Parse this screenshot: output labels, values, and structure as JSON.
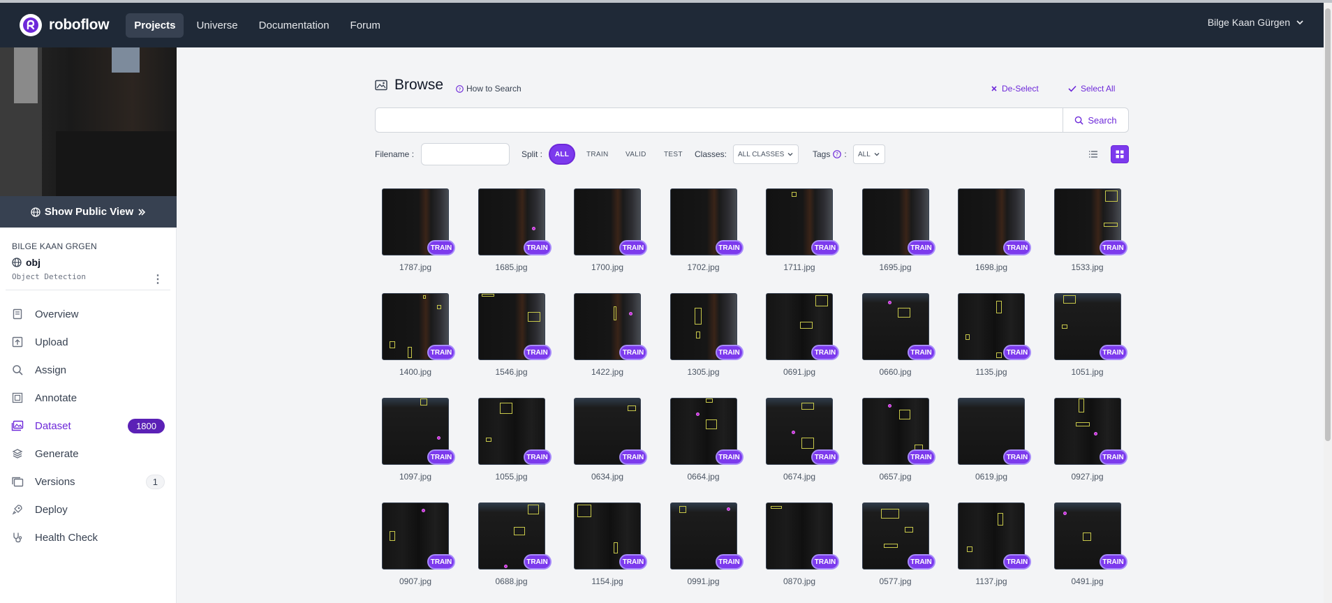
{
  "nav": {
    "brand": "roboflow",
    "links": [
      "Projects",
      "Universe",
      "Documentation",
      "Forum"
    ],
    "user": "Bilge Kaan Gürgen"
  },
  "sidebar": {
    "public_view": "Show Public View",
    "owner": "BILGE KAAN GRGEN",
    "project_name": "obj",
    "project_type": "Object Detection",
    "items": [
      {
        "label": "Overview",
        "icon": "overview-icon"
      },
      {
        "label": "Upload",
        "icon": "upload-icon"
      },
      {
        "label": "Assign",
        "icon": "search-icon"
      },
      {
        "label": "Annotate",
        "icon": "annotate-icon"
      },
      {
        "label": "Dataset",
        "icon": "images-icon",
        "badge": "1800"
      },
      {
        "label": "Generate",
        "icon": "layers-icon"
      },
      {
        "label": "Versions",
        "icon": "versions-icon",
        "badge": "1"
      },
      {
        "label": "Deploy",
        "icon": "rocket-icon"
      },
      {
        "label": "Health Check",
        "icon": "stethoscope-icon"
      }
    ]
  },
  "browse": {
    "title": "Browse",
    "how_to": "How to Search",
    "deselect": "De-Select",
    "select_all": "Select All",
    "search_button": "Search",
    "search_value": ""
  },
  "filters": {
    "filename_label": "Filename :",
    "filename_value": "",
    "split_label": "Split :",
    "splits": [
      "ALL",
      "TRAIN",
      "VALID",
      "TEST"
    ],
    "classes_label": "Classes:",
    "classes_value": "ALL CLASSES",
    "tags_label": "Tags",
    "tags_value": "ALL"
  },
  "images": [
    {
      "name": "1787.jpg",
      "split": "TRAIN"
    },
    {
      "name": "1685.jpg",
      "split": "TRAIN"
    },
    {
      "name": "1700.jpg",
      "split": "TRAIN"
    },
    {
      "name": "1702.jpg",
      "split": "TRAIN"
    },
    {
      "name": "1711.jpg",
      "split": "TRAIN"
    },
    {
      "name": "1695.jpg",
      "split": "TRAIN"
    },
    {
      "name": "1698.jpg",
      "split": "TRAIN"
    },
    {
      "name": "1533.jpg",
      "split": "TRAIN"
    },
    {
      "name": "1400.jpg",
      "split": "TRAIN"
    },
    {
      "name": "1546.jpg",
      "split": "TRAIN"
    },
    {
      "name": "1422.jpg",
      "split": "TRAIN"
    },
    {
      "name": "1305.jpg",
      "split": "TRAIN"
    },
    {
      "name": "0691.jpg",
      "split": "TRAIN"
    },
    {
      "name": "0660.jpg",
      "split": "TRAIN"
    },
    {
      "name": "1135.jpg",
      "split": "TRAIN"
    },
    {
      "name": "1051.jpg",
      "split": "TRAIN"
    },
    {
      "name": "1097.jpg",
      "split": "TRAIN"
    },
    {
      "name": "1055.jpg",
      "split": "TRAIN"
    },
    {
      "name": "0634.jpg",
      "split": "TRAIN"
    },
    {
      "name": "0664.jpg",
      "split": "TRAIN"
    },
    {
      "name": "0674.jpg",
      "split": "TRAIN"
    },
    {
      "name": "0657.jpg",
      "split": "TRAIN"
    },
    {
      "name": "0619.jpg",
      "split": "TRAIN"
    },
    {
      "name": "0927.jpg",
      "split": "TRAIN"
    },
    {
      "name": "0907.jpg",
      "split": "TRAIN"
    },
    {
      "name": "0688.jpg",
      "split": "TRAIN"
    },
    {
      "name": "1154.jpg",
      "split": "TRAIN"
    },
    {
      "name": "0991.jpg",
      "split": "TRAIN"
    },
    {
      "name": "0870.jpg",
      "split": "TRAIN"
    },
    {
      "name": "0577.jpg",
      "split": "TRAIN"
    },
    {
      "name": "1137.jpg",
      "split": "TRAIN"
    },
    {
      "name": "0491.jpg",
      "split": "TRAIN"
    }
  ],
  "colors": {
    "accent": "#7c3aed",
    "nav_bg": "#1f2937"
  }
}
